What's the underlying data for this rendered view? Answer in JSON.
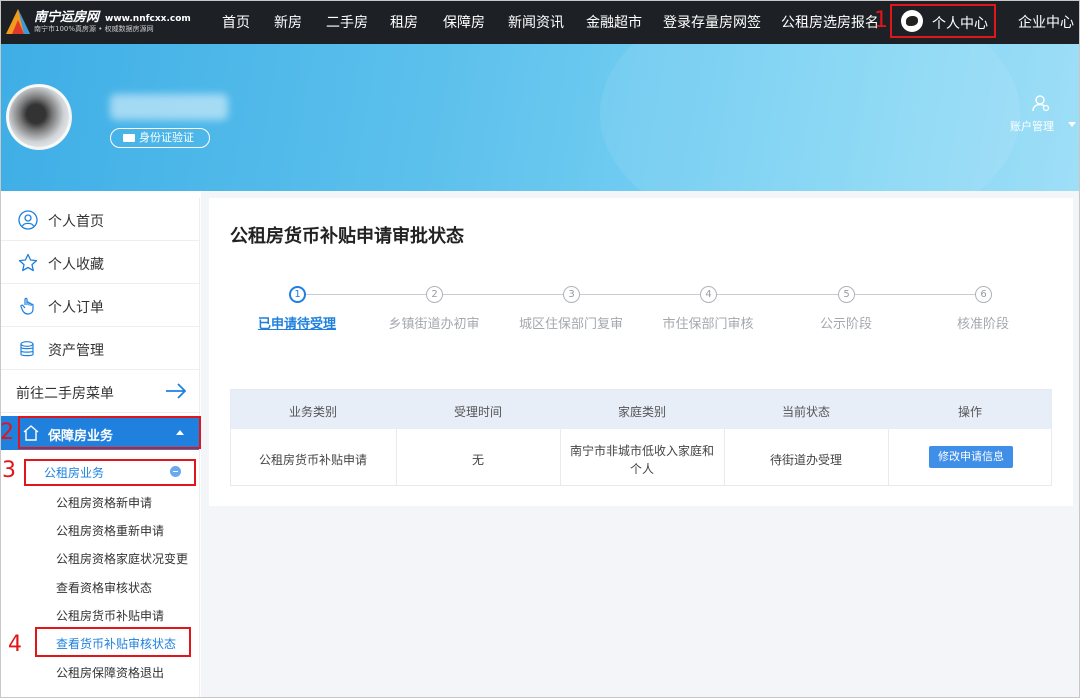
{
  "site": {
    "logo_title": "南宁运房网",
    "logo_domain": "www.nnfcxx.com",
    "logo_sub": "南宁市100%真房源 • 权威数据房源网"
  },
  "nav": {
    "items": [
      "首页",
      "新房",
      "二手房",
      "租房",
      "保障房",
      "新闻资讯",
      "金融超市",
      "登录存量房网签",
      "公租房选房报名"
    ],
    "profile": "个人中心",
    "enterprise": "企业中心"
  },
  "banner": {
    "id_verify": "身份证验证",
    "account": "账户管理"
  },
  "sidebar": {
    "items": [
      "个人首页",
      "个人收藏",
      "个人订单",
      "资产管理"
    ],
    "secondhand": "前往二手房菜单",
    "active_group": "保障房业务",
    "sub_head": "公租房业务",
    "sub_items": [
      "公租房资格新申请",
      "公租房资格重新申请",
      "公租房资格家庭状况变更",
      "查看资格审核状态",
      "公租房货币补贴申请",
      "查看货币补贴审核状态",
      "公租房保障资格退出"
    ]
  },
  "annotations": [
    "1",
    "2",
    "3",
    "4"
  ],
  "main": {
    "title": "公租房货币补贴申请审批状态",
    "steps": [
      {
        "num": "1",
        "label": "已申请待受理",
        "active": true
      },
      {
        "num": "2",
        "label": "乡镇街道办初审",
        "active": false
      },
      {
        "num": "3",
        "label": "城区住保部门复审",
        "active": false
      },
      {
        "num": "4",
        "label": "市住保部门审核",
        "active": false
      },
      {
        "num": "5",
        "label": "公示阶段",
        "active": false
      },
      {
        "num": "6",
        "label": "核准阶段",
        "active": false
      }
    ],
    "table": {
      "headers": [
        "业务类别",
        "受理时间",
        "家庭类别",
        "当前状态",
        "操作"
      ],
      "row": {
        "category": "公租房货币补贴申请",
        "time": "无",
        "family_line1": "南宁市非城市低收入家庭和",
        "family_line2": "个人",
        "status": "待街道办受理",
        "action": "修改申请信息"
      }
    }
  },
  "colors": {
    "nav_bg": "#1d2126",
    "accent": "#1f80de",
    "annotation_red": "#e0161b",
    "button": "#3f8ee8"
  }
}
